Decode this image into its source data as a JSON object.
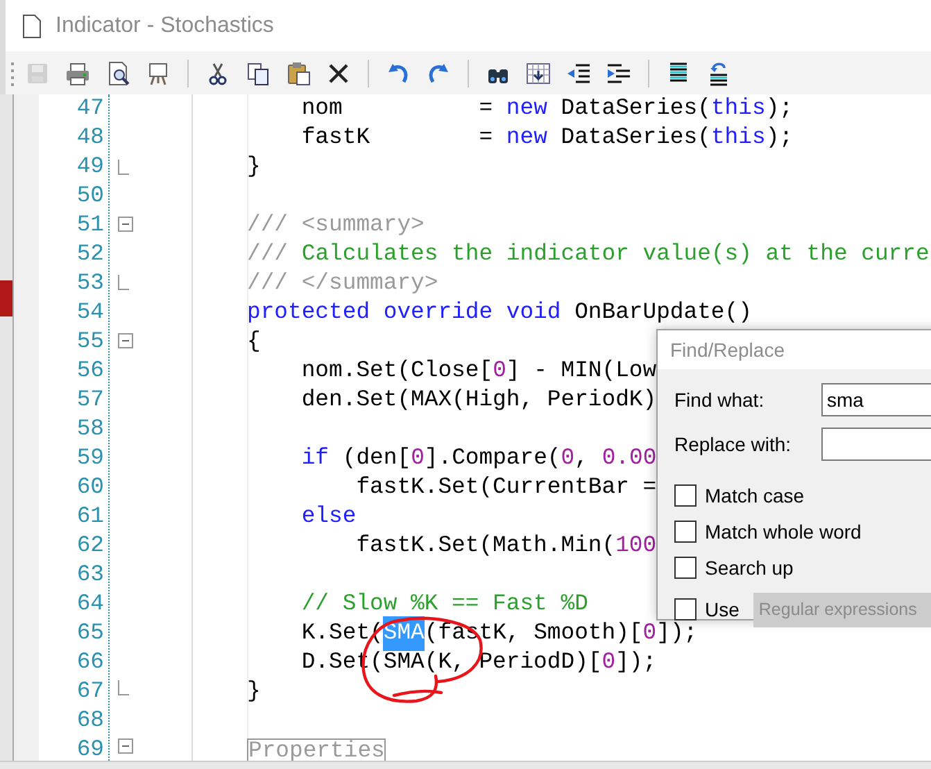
{
  "window": {
    "title": "Indicator - Stochastics"
  },
  "toolbar": [
    {
      "kind": "save",
      "disabled": true
    },
    {
      "kind": "print",
      "disabled": false
    },
    {
      "kind": "preview",
      "disabled": false
    },
    {
      "kind": "easel",
      "disabled": false
    },
    {
      "kind": "separator"
    },
    {
      "kind": "cut",
      "disabled": false
    },
    {
      "kind": "copy",
      "disabled": false
    },
    {
      "kind": "paste",
      "disabled": false
    },
    {
      "kind": "delete",
      "disabled": false
    },
    {
      "kind": "separator"
    },
    {
      "kind": "undo",
      "disabled": false
    },
    {
      "kind": "redo",
      "disabled": false
    },
    {
      "kind": "separator"
    },
    {
      "kind": "find",
      "disabled": false
    },
    {
      "kind": "grid",
      "disabled": false
    },
    {
      "kind": "outdent",
      "disabled": false
    },
    {
      "kind": "indent",
      "disabled": false
    },
    {
      "kind": "separator"
    },
    {
      "kind": "comment",
      "disabled": false
    },
    {
      "kind": "uncomment",
      "disabled": false
    }
  ],
  "editor": {
    "lines": [
      {
        "number": "47",
        "collapsible": false,
        "block_end": false,
        "tokens": [
          {
            "kind": "plain",
            "text": "    nom          = "
          },
          {
            "kind": "keyword",
            "text": "new"
          },
          {
            "kind": "plain",
            "text": " DataSeries("
          },
          {
            "kind": "keyword",
            "text": "this"
          },
          {
            "kind": "plain",
            "text": ");"
          }
        ]
      },
      {
        "number": "48",
        "collapsible": false,
        "block_end": false,
        "tokens": [
          {
            "kind": "plain",
            "text": "    fastK        = "
          },
          {
            "kind": "keyword",
            "text": "new"
          },
          {
            "kind": "plain",
            "text": " DataSeries("
          },
          {
            "kind": "keyword",
            "text": "this"
          },
          {
            "kind": "plain",
            "text": ");"
          }
        ]
      },
      {
        "number": "49",
        "collapsible": false,
        "block_end": true,
        "tokens": [
          {
            "kind": "plain",
            "text": "}"
          }
        ]
      },
      {
        "number": "50",
        "collapsible": false,
        "block_end": false
      },
      {
        "number": "51",
        "collapsible": true,
        "block_end": false,
        "tokens": [
          {
            "kind": "doc",
            "text": "/// <summary>"
          }
        ]
      },
      {
        "number": "52",
        "collapsible": false,
        "block_end": false,
        "tokens": [
          {
            "kind": "doc",
            "text": "/// "
          },
          {
            "kind": "comment",
            "text": "Calculates the indicator value(s) at the curre"
          }
        ]
      },
      {
        "number": "53",
        "collapsible": false,
        "block_end": true,
        "tokens": [
          {
            "kind": "doc",
            "text": "/// </summary>"
          }
        ]
      },
      {
        "number": "54",
        "collapsible": false,
        "block_end": false,
        "tokens": [
          {
            "kind": "keyword",
            "text": "protected override void"
          },
          {
            "kind": "plain",
            "text": " OnBarUpdate()"
          }
        ]
      },
      {
        "number": "55",
        "collapsible": true,
        "block_end": false,
        "tokens": [
          {
            "kind": "plain",
            "text": "{"
          }
        ]
      },
      {
        "number": "56",
        "collapsible": false,
        "block_end": false,
        "tokens": [
          {
            "kind": "plain",
            "text": "    nom.Set(Close["
          },
          {
            "kind": "number",
            "text": "0"
          },
          {
            "kind": "plain",
            "text": "] - MIN(Low"
          }
        ]
      },
      {
        "number": "57",
        "collapsible": false,
        "block_end": false,
        "tokens": [
          {
            "kind": "plain",
            "text": "    den.Set(MAX(High, PeriodK)"
          }
        ]
      },
      {
        "number": "58",
        "collapsible": false,
        "block_end": false
      },
      {
        "number": "59",
        "collapsible": false,
        "block_end": false,
        "tokens": [
          {
            "kind": "keyword",
            "text": "    if"
          },
          {
            "kind": "plain",
            "text": " (den["
          },
          {
            "kind": "number",
            "text": "0"
          },
          {
            "kind": "plain",
            "text": "].Compare("
          },
          {
            "kind": "number",
            "text": "0"
          },
          {
            "kind": "plain",
            "text": ", "
          },
          {
            "kind": "number",
            "text": "0.00"
          }
        ]
      },
      {
        "number": "60",
        "collapsible": false,
        "block_end": false,
        "tokens": [
          {
            "kind": "plain",
            "text": "        fastK.Set(CurrentBar ="
          }
        ]
      },
      {
        "number": "61",
        "collapsible": false,
        "block_end": false,
        "tokens": [
          {
            "kind": "keyword",
            "text": "    else"
          }
        ]
      },
      {
        "number": "62",
        "collapsible": false,
        "block_end": false,
        "tokens": [
          {
            "kind": "plain",
            "text": "        fastK.Set(Math.Min("
          },
          {
            "kind": "number",
            "text": "100"
          }
        ]
      },
      {
        "number": "63",
        "collapsible": false,
        "block_end": false
      },
      {
        "number": "64",
        "collapsible": false,
        "block_end": false,
        "tokens": [
          {
            "kind": "comment",
            "text": "    // Slow %K == Fast %D"
          }
        ]
      },
      {
        "number": "65",
        "collapsible": false,
        "block_end": false,
        "tokens": [
          {
            "kind": "plain",
            "text": "    K.Set("
          },
          {
            "kind": "selection",
            "text": "SMA"
          },
          {
            "kind": "plain",
            "text": "(fastK, Smooth)["
          },
          {
            "kind": "number",
            "text": "0"
          },
          {
            "kind": "plain",
            "text": "]);"
          }
        ]
      },
      {
        "number": "66",
        "collapsible": false,
        "block_end": false,
        "tokens": [
          {
            "kind": "plain",
            "text": "    D.Set(SMA(K, PeriodD)["
          },
          {
            "kind": "number",
            "text": "0"
          },
          {
            "kind": "plain",
            "text": "]);"
          }
        ]
      },
      {
        "number": "67",
        "collapsible": false,
        "block_end": true,
        "tokens": [
          {
            "kind": "plain",
            "text": "}"
          }
        ]
      },
      {
        "number": "68",
        "collapsible": false,
        "block_end": false
      },
      {
        "number": "69",
        "collapsible": true,
        "block_end": false,
        "tokens": [
          {
            "kind": "region",
            "text": "Properties"
          }
        ]
      }
    ]
  },
  "find_replace": {
    "title": "Find/Replace",
    "fields": [
      {
        "label": "Find what:",
        "value": "sma"
      },
      {
        "label": "Replace with:"
      }
    ],
    "options": [
      {
        "label": "Match case",
        "checked": false
      },
      {
        "label": "Match whole word",
        "checked": false
      },
      {
        "label": "Search up",
        "checked": false
      },
      {
        "label": "Use",
        "checked": false
      }
    ],
    "mode": {
      "value": "Regular expressions",
      "disabled": true
    }
  }
}
